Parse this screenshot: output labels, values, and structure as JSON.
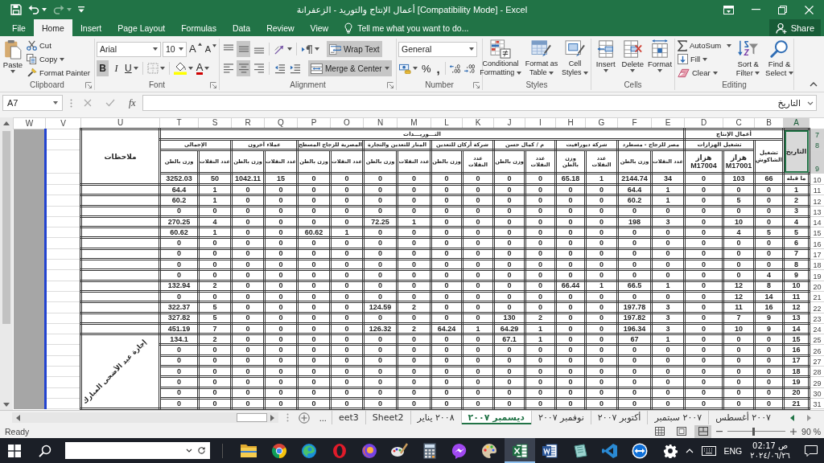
{
  "title_bar": {
    "title": "أعمال الإنتاج والتوريد - الزعفرانة [Compatibility Mode] - Excel"
  },
  "ribbon_tabs": [
    {
      "label": "View",
      "selected": false
    },
    {
      "label": "Review",
      "selected": false
    },
    {
      "label": "Data",
      "selected": false
    },
    {
      "label": "Formulas",
      "selected": false
    },
    {
      "label": "Page Layout",
      "selected": false
    },
    {
      "label": "Insert",
      "selected": false
    },
    {
      "label": "Home",
      "selected": true
    },
    {
      "label": "File",
      "selected": false
    }
  ],
  "tell_me": {
    "placeholder": "Tell me what you want to do..."
  },
  "share": "Share",
  "ribbon": {
    "clipboard": {
      "label": "Clipboard",
      "paste": "Paste",
      "cut": "Cut",
      "copy": "Copy",
      "format_painter": "Format Painter"
    },
    "font": {
      "label": "Font",
      "font_name": "Arial",
      "font_size": "10",
      "grow": "A",
      "shrink": "A",
      "styles": [
        {
          "kind": "underline",
          "label": "U",
          "on": false
        },
        {
          "kind": "italic",
          "label": "I",
          "on": false
        },
        {
          "kind": "bold",
          "label": "B",
          "on": true
        }
      ],
      "font_color": "A"
    },
    "alignment": {
      "label": "Alignment",
      "vertical": [
        {
          "kind": "top",
          "on": false
        },
        {
          "kind": "middle",
          "on": true
        },
        {
          "kind": "bottom",
          "on": false
        }
      ],
      "horizontal": [
        {
          "kind": "left",
          "on": false
        },
        {
          "kind": "center",
          "on": true
        },
        {
          "kind": "right",
          "on": false
        }
      ],
      "wrap_text": {
        "label": "Wrap Text",
        "on": true
      },
      "merge_center": {
        "label": "Merge & Center",
        "on": true
      }
    },
    "number": {
      "label": "Number",
      "format": "General",
      "percent": "%",
      "comma": ","
    },
    "styles": {
      "label": "Styles",
      "buttons": [
        {
          "kind": "cell_styles",
          "label": "Cell Styles"
        },
        {
          "kind": "table",
          "label": "Format as Table"
        },
        {
          "kind": "conditional",
          "label": "Conditional Formatting"
        }
      ]
    },
    "cells": {
      "label": "Cells",
      "buttons": [
        {
          "kind": "format",
          "label": "Format"
        },
        {
          "kind": "delete",
          "label": "Delete"
        },
        {
          "kind": "insert",
          "label": "Insert"
        }
      ]
    },
    "editing": {
      "label": "Editing",
      "autosum": "AutoSum",
      "fill": "Fill",
      "clear": "Clear",
      "sort_filter": "Sort & Filter",
      "find_select": "Find & Select"
    }
  },
  "formula_bar": {
    "name_box": "A7",
    "function_label": "fx",
    "value": "التاريخ"
  },
  "sheet": {
    "columns": [
      {
        "label": "A",
        "selected": true
      },
      {
        "label": "B",
        "selected": false
      },
      {
        "label": "C",
        "selected": false
      },
      {
        "label": "D",
        "selected": false
      },
      {
        "label": "E",
        "selected": false
      },
      {
        "label": "F",
        "selected": false
      },
      {
        "label": "G",
        "selected": false
      },
      {
        "label": "H",
        "selected": false
      },
      {
        "label": "I",
        "selected": false
      },
      {
        "label": "J",
        "selected": false
      },
      {
        "label": "K",
        "selected": false
      },
      {
        "label": "L",
        "selected": false
      },
      {
        "label": "M",
        "selected": false
      },
      {
        "label": "N",
        "selected": false
      },
      {
        "label": "O",
        "selected": false
      },
      {
        "label": "P",
        "selected": false
      },
      {
        "label": "Q",
        "selected": false
      },
      {
        "label": "R",
        "selected": false
      },
      {
        "label": "S",
        "selected": false
      },
      {
        "label": "T",
        "selected": false
      },
      {
        "label": "U",
        "selected": false
      },
      {
        "label": "V",
        "selected": false
      },
      {
        "label": "W",
        "selected": false
      }
    ],
    "header_rows": [
      {
        "label": "7",
        "selected": true
      },
      {
        "label": "8",
        "selected": true
      },
      {
        "label": "9",
        "selected": true
      }
    ],
    "date_header": {
      "text": "التاريخ",
      "selected": true
    },
    "production": {
      "title": "أعمال الإنتاج",
      "hammer": "تشغيل الشاكوش",
      "vibrators": "تشغيل الهزازات",
      "units": [
        "هزاز M17001",
        "هزاز M17004"
      ]
    },
    "supplies": {
      "title": "التـــوريـــدات",
      "groups": [
        {
          "name": "مصر للزجاج - مسطرد",
          "columns": [
            "عدد النقلات",
            "وزن بالطن"
          ]
        },
        {
          "name": "شركة ديورافيت",
          "columns": [
            "عدد النقلات",
            "وزن بالطن"
          ]
        },
        {
          "name": "م / كمال حسن",
          "columns": [
            "عدد النقلات",
            "وزن بالطن"
          ]
        },
        {
          "name": "شركة أركان للتعدين",
          "columns": [
            "عدد النقلات",
            "وزن بالطن"
          ]
        },
        {
          "name": "المنار للتعدين والتجارة",
          "columns": [
            "عدد النقلات",
            "وزن بالطن"
          ]
        },
        {
          "name": "المصرية للزجاج المسطح",
          "columns": [
            "عدد النقلات",
            "وزن بالطن"
          ]
        },
        {
          "name": "عملاء آخرون",
          "columns": [
            "عدد النقلات",
            "وزن بالطن"
          ]
        },
        {
          "name": "الإجمالي",
          "columns": [
            "عدد النقلات",
            "وزن بالطن"
          ]
        }
      ]
    },
    "notes": {
      "header": "ملاحظات",
      "merged_note": "إجازة عيد الأضحى المبارك"
    },
    "rows": [
      {
        "label": "10",
        "selected": false,
        "cells": [
          "ما قبله",
          "66",
          "103",
          "0",
          "34",
          "2144.74",
          "1",
          "65.18",
          "0",
          "0",
          "0",
          "0",
          "0",
          "0",
          "0",
          "0",
          "15",
          "1042.11",
          "50",
          "3252.03"
        ]
      },
      {
        "label": "11",
        "selected": false,
        "cells": [
          "1",
          "0",
          "0",
          "0",
          "1",
          "64.4",
          "0",
          "0",
          "0",
          "0",
          "0",
          "0",
          "0",
          "0",
          "0",
          "0",
          "0",
          "0",
          "1",
          "64.4"
        ]
      },
      {
        "label": "12",
        "selected": false,
        "cells": [
          "2",
          "0",
          "5",
          "0",
          "1",
          "60.2",
          "0",
          "0",
          "0",
          "0",
          "0",
          "0",
          "0",
          "0",
          "0",
          "0",
          "0",
          "0",
          "1",
          "60.2"
        ]
      },
      {
        "label": "13",
        "selected": false,
        "cells": [
          "3",
          "0",
          "0",
          "0",
          "0",
          "0",
          "0",
          "0",
          "0",
          "0",
          "0",
          "0",
          "0",
          "0",
          "0",
          "0",
          "0",
          "0",
          "0",
          "0"
        ]
      },
      {
        "label": "14",
        "selected": false,
        "cells": [
          "4",
          "0",
          "10",
          "0",
          "3",
          "198",
          "0",
          "0",
          "0",
          "0",
          "0",
          "0",
          "1",
          "72.25",
          "0",
          "0",
          "0",
          "0",
          "4",
          "270.25"
        ]
      },
      {
        "label": "15",
        "selected": false,
        "cells": [
          "5",
          "5",
          "4",
          "0",
          "0",
          "0",
          "0",
          "0",
          "0",
          "0",
          "0",
          "0",
          "0",
          "0",
          "1",
          "60.62",
          "0",
          "0",
          "1",
          "60.62"
        ]
      },
      {
        "label": "16",
        "selected": false,
        "cells": [
          "6",
          "0",
          "0",
          "0",
          "0",
          "0",
          "0",
          "0",
          "0",
          "0",
          "0",
          "0",
          "0",
          "0",
          "0",
          "0",
          "0",
          "0",
          "0",
          "0"
        ]
      },
      {
        "label": "17",
        "selected": false,
        "cells": [
          "7",
          "0",
          "0",
          "0",
          "0",
          "0",
          "0",
          "0",
          "0",
          "0",
          "0",
          "0",
          "0",
          "0",
          "0",
          "0",
          "0",
          "0",
          "0",
          "0"
        ]
      },
      {
        "label": "18",
        "selected": false,
        "cells": [
          "8",
          "0",
          "0",
          "0",
          "0",
          "0",
          "0",
          "0",
          "0",
          "0",
          "0",
          "0",
          "0",
          "0",
          "0",
          "0",
          "0",
          "0",
          "0",
          "0"
        ]
      },
      {
        "label": "19",
        "selected": false,
        "cells": [
          "9",
          "4",
          "0",
          "0",
          "0",
          "0",
          "0",
          "0",
          "0",
          "0",
          "0",
          "0",
          "0",
          "0",
          "0",
          "0",
          "0",
          "0",
          "0",
          "0"
        ]
      },
      {
        "label": "20",
        "selected": false,
        "cells": [
          "10",
          "8",
          "12",
          "0",
          "1",
          "66.5",
          "1",
          "66.44",
          "0",
          "0",
          "0",
          "0",
          "0",
          "0",
          "0",
          "0",
          "0",
          "0",
          "2",
          "132.94"
        ]
      },
      {
        "label": "21",
        "selected": false,
        "cells": [
          "11",
          "14",
          "12",
          "0",
          "0",
          "0",
          "0",
          "0",
          "0",
          "0",
          "0",
          "0",
          "0",
          "0",
          "0",
          "0",
          "0",
          "0",
          "0",
          "0"
        ]
      },
      {
        "label": "22",
        "selected": false,
        "cells": [
          "12",
          "16",
          "11",
          "0",
          "3",
          "197.78",
          "0",
          "0",
          "0",
          "0",
          "0",
          "0",
          "2",
          "124.59",
          "0",
          "0",
          "0",
          "0",
          "5",
          "322.37"
        ]
      },
      {
        "label": "23",
        "selected": false,
        "cells": [
          "13",
          "9",
          "7",
          "0",
          "3",
          "197.82",
          "0",
          "0",
          "2",
          "130",
          "0",
          "0",
          "0",
          "0",
          "0",
          "0",
          "0",
          "0",
          "5",
          "327.82"
        ]
      },
      {
        "label": "24",
        "selected": false,
        "cells": [
          "14",
          "9",
          "10",
          "0",
          "3",
          "196.34",
          "0",
          "0",
          "1",
          "64.29",
          "1",
          "64.24",
          "2",
          "126.32",
          "0",
          "0",
          "0",
          "0",
          "7",
          "451.19"
        ]
      },
      {
        "label": "25",
        "selected": false,
        "cells": [
          "15",
          "0",
          "0",
          "0",
          "1",
          "67",
          "0",
          "0",
          "1",
          "67.1",
          "0",
          "0",
          "0",
          "0",
          "0",
          "0",
          "0",
          "0",
          "2",
          "134.1"
        ]
      },
      {
        "label": "26",
        "selected": false,
        "cells": [
          "16",
          "0",
          "0",
          "0",
          "0",
          "0",
          "0",
          "0",
          "0",
          "0",
          "0",
          "0",
          "0",
          "0",
          "0",
          "0",
          "0",
          "0",
          "0",
          "0"
        ]
      },
      {
        "label": "27",
        "selected": false,
        "cells": [
          "17",
          "0",
          "0",
          "0",
          "0",
          "0",
          "0",
          "0",
          "0",
          "0",
          "0",
          "0",
          "0",
          "0",
          "0",
          "0",
          "0",
          "0",
          "0",
          "0"
        ]
      },
      {
        "label": "28",
        "selected": false,
        "cells": [
          "18",
          "0",
          "0",
          "0",
          "0",
          "0",
          "0",
          "0",
          "0",
          "0",
          "0",
          "0",
          "0",
          "0",
          "0",
          "0",
          "0",
          "0",
          "0",
          "0"
        ]
      },
      {
        "label": "29",
        "selected": false,
        "cells": [
          "19",
          "0",
          "0",
          "0",
          "0",
          "0",
          "0",
          "0",
          "0",
          "0",
          "0",
          "0",
          "0",
          "0",
          "0",
          "0",
          "0",
          "0",
          "0",
          "0"
        ]
      },
      {
        "label": "30",
        "selected": false,
        "cells": [
          "20",
          "0",
          "0",
          "0",
          "0",
          "0",
          "0",
          "0",
          "0",
          "0",
          "0",
          "0",
          "0",
          "0",
          "0",
          "0",
          "0",
          "0",
          "0",
          "0"
        ]
      },
      {
        "label": "31",
        "selected": false,
        "cells": [
          "21",
          "0",
          "0",
          "0",
          "0",
          "0",
          "0",
          "0",
          "0",
          "0",
          "0",
          "0",
          "0",
          "0",
          "0",
          "0",
          "0",
          "0",
          "0",
          "0"
        ]
      }
    ]
  },
  "sheet_tabs": [
    {
      "label": "٢٠٠٧ أغسطس",
      "selected": false
    },
    {
      "label": "٢٠٠٧ سبتمبر",
      "selected": false
    },
    {
      "label": "أكتوبر ٢٠٠٧",
      "selected": false
    },
    {
      "label": "نوفمبر ٢٠٠٧",
      "selected": false
    },
    {
      "label": "ديسمبر ٢٠٠٧",
      "selected": true
    },
    {
      "label": "٢٠٠٨ يناير",
      "selected": false
    },
    {
      "label": "Sheet2",
      "selected": false
    },
    {
      "label": "eet3",
      "selected": false
    }
  ],
  "more_sheets": "...",
  "status_bar": {
    "status": "Ready",
    "views": [
      {
        "kind": "normal",
        "selected": false
      },
      {
        "kind": "page_layout",
        "selected": false
      },
      {
        "kind": "page_break",
        "selected": true
      }
    ],
    "zoom": {
      "level": 0.45,
      "reading": "90 %"
    }
  },
  "taskbar": {
    "apps": [
      {
        "kind": "folder",
        "active": false
      },
      {
        "kind": "segmented_ball",
        "active": false
      },
      {
        "kind": "swirl",
        "active": false
      },
      {
        "kind": "ring",
        "active": false
      },
      {
        "kind": "globe",
        "active": false
      },
      {
        "kind": "palette_brush",
        "active": false
      },
      {
        "kind": "calculator",
        "active": false
      },
      {
        "kind": "chat",
        "active": false
      },
      {
        "kind": "palette",
        "active": false
      },
      {
        "kind": "spreadsheet",
        "active": true
      },
      {
        "kind": "document",
        "active": false
      },
      {
        "kind": "tablet",
        "active": false
      },
      {
        "kind": "band",
        "active": false
      },
      {
        "kind": "arrows",
        "active": false
      },
      {
        "kind": "gear",
        "active": false
      }
    ],
    "language": "ENG",
    "time": "02:17 ص",
    "date": "٢٠٢٤/٠٦/٢٦"
  }
}
